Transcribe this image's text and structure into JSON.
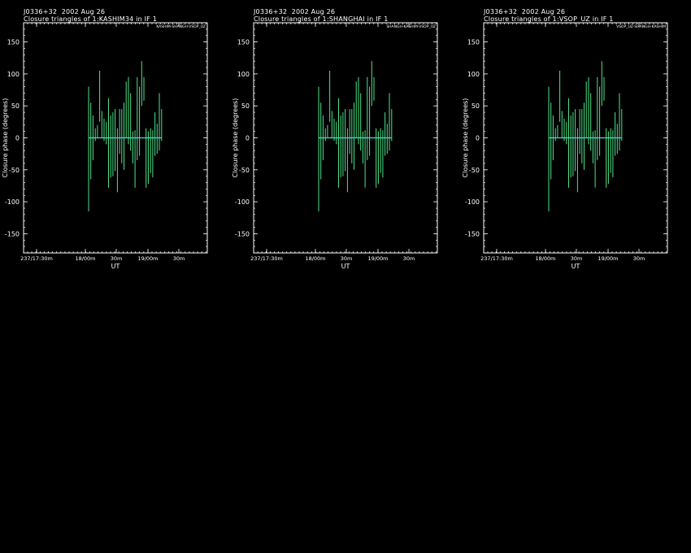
{
  "colors": {
    "background": "#000000",
    "axes": "#ffffff",
    "data": "#4ee38a",
    "zero_line": "#45e0c8"
  },
  "chart_data": [
    {
      "type": "scatter",
      "source": "J0336+32",
      "date": "2002 Aug 26",
      "title": "Closure triangles of 1:KASHIM34 in IF 1",
      "triangle_label": "KASHIM-SHANGH-VSOP_UZ",
      "xlabel": "UT",
      "ylabel": "Closure phase   (degrees)",
      "ylim": [
        -180,
        180
      ],
      "yticks": [
        -150,
        -100,
        -50,
        0,
        50,
        100,
        150
      ],
      "xticks": [
        "237/17:30m",
        "18/00m",
        "30m",
        "19/00m",
        "30m"
      ],
      "bars": [
        [
          0,
          80,
          -115
        ],
        [
          1,
          55,
          -65
        ],
        [
          2,
          35,
          -35
        ],
        [
          3,
          15,
          -5
        ],
        [
          4,
          20,
          0
        ],
        [
          5,
          105,
          25
        ],
        [
          6,
          42,
          0
        ],
        [
          7,
          30,
          -5
        ],
        [
          8,
          25,
          -10
        ],
        [
          9,
          62,
          -78
        ],
        [
          10,
          35,
          -62
        ],
        [
          11,
          40,
          -60
        ],
        [
          12,
          45,
          -52
        ],
        [
          13,
          15,
          -85
        ],
        [
          14,
          45,
          -25
        ],
        [
          15,
          45,
          -40
        ],
        [
          16,
          55,
          -50
        ],
        [
          17,
          88,
          0
        ],
        [
          18,
          95,
          -10
        ],
        [
          19,
          70,
          -20
        ],
        [
          20,
          10,
          -40
        ],
        [
          21,
          12,
          -78
        ],
        [
          22,
          95,
          -35
        ],
        [
          23,
          80,
          -28
        ],
        [
          24,
          120,
          50
        ],
        [
          25,
          95,
          58
        ],
        [
          26,
          15,
          -78
        ],
        [
          27,
          10,
          -72
        ],
        [
          28,
          15,
          -55
        ],
        [
          29,
          12,
          -62
        ],
        [
          30,
          40,
          -28
        ],
        [
          31,
          22,
          -25
        ],
        [
          32,
          70,
          -20
        ],
        [
          33,
          45,
          -5
        ]
      ]
    },
    {
      "type": "scatter",
      "source": "J0336+32",
      "date": "2002 Aug 26",
      "title": "Closure triangles of 1:SHANGHAI in IF 1",
      "triangle_label": "SHANGH-KASHIM-VSOP_UZ",
      "xlabel": "UT",
      "ylabel": "Closure phase   (degrees)",
      "ylim": [
        -180,
        180
      ],
      "yticks": [
        -150,
        -100,
        -50,
        0,
        50,
        100,
        150
      ],
      "xticks": [
        "237/17:30m",
        "18/00m",
        "30m",
        "19/00m",
        "30m"
      ],
      "bars": [
        [
          0,
          80,
          -115
        ],
        [
          1,
          55,
          -65
        ],
        [
          2,
          35,
          -35
        ],
        [
          3,
          15,
          -5
        ],
        [
          4,
          20,
          0
        ],
        [
          5,
          105,
          25
        ],
        [
          6,
          42,
          0
        ],
        [
          7,
          30,
          -5
        ],
        [
          8,
          25,
          -10
        ],
        [
          9,
          62,
          -78
        ],
        [
          10,
          35,
          -62
        ],
        [
          11,
          40,
          -60
        ],
        [
          12,
          45,
          -52
        ],
        [
          13,
          15,
          -85
        ],
        [
          14,
          45,
          -25
        ],
        [
          15,
          45,
          -40
        ],
        [
          16,
          55,
          -50
        ],
        [
          17,
          88,
          0
        ],
        [
          18,
          95,
          -10
        ],
        [
          19,
          70,
          -20
        ],
        [
          20,
          10,
          -40
        ],
        [
          21,
          12,
          -78
        ],
        [
          22,
          95,
          -35
        ],
        [
          23,
          80,
          -28
        ],
        [
          24,
          120,
          50
        ],
        [
          25,
          95,
          58
        ],
        [
          26,
          15,
          -78
        ],
        [
          27,
          10,
          -72
        ],
        [
          28,
          15,
          -55
        ],
        [
          29,
          12,
          -62
        ],
        [
          30,
          40,
          -28
        ],
        [
          31,
          22,
          -25
        ],
        [
          32,
          70,
          -20
        ],
        [
          33,
          45,
          -5
        ]
      ]
    },
    {
      "type": "scatter",
      "source": "J0336+32",
      "date": "2002 Aug 26",
      "title": "Closure triangles of 1:VSOP_UZ in IF 1",
      "triangle_label": "VSOP_UZ-SHANGH-KASHIM",
      "xlabel": "UT",
      "ylabel": "Closure phase   (degrees)",
      "ylim": [
        -180,
        180
      ],
      "yticks": [
        -150,
        -100,
        -50,
        0,
        50,
        100,
        150
      ],
      "xticks": [
        "237/17:30m",
        "18/00m",
        "30m",
        "19/00m",
        "30m"
      ],
      "bars": [
        [
          0,
          80,
          -115
        ],
        [
          1,
          55,
          -65
        ],
        [
          2,
          35,
          -35
        ],
        [
          3,
          15,
          -5
        ],
        [
          4,
          20,
          0
        ],
        [
          5,
          105,
          25
        ],
        [
          6,
          42,
          0
        ],
        [
          7,
          30,
          -5
        ],
        [
          8,
          25,
          -10
        ],
        [
          9,
          62,
          -78
        ],
        [
          10,
          35,
          -62
        ],
        [
          11,
          40,
          -60
        ],
        [
          12,
          45,
          -52
        ],
        [
          13,
          15,
          -85
        ],
        [
          14,
          45,
          -25
        ],
        [
          15,
          45,
          -40
        ],
        [
          16,
          55,
          -50
        ],
        [
          17,
          88,
          0
        ],
        [
          18,
          95,
          -10
        ],
        [
          19,
          70,
          -20
        ],
        [
          20,
          10,
          -40
        ],
        [
          21,
          12,
          -78
        ],
        [
          22,
          95,
          -35
        ],
        [
          23,
          80,
          -28
        ],
        [
          24,
          120,
          50
        ],
        [
          25,
          95,
          58
        ],
        [
          26,
          15,
          -78
        ],
        [
          27,
          10,
          -72
        ],
        [
          28,
          15,
          -55
        ],
        [
          29,
          12,
          -62
        ],
        [
          30,
          40,
          -28
        ],
        [
          31,
          22,
          -25
        ],
        [
          32,
          70,
          -20
        ],
        [
          33,
          45,
          -5
        ]
      ]
    }
  ]
}
